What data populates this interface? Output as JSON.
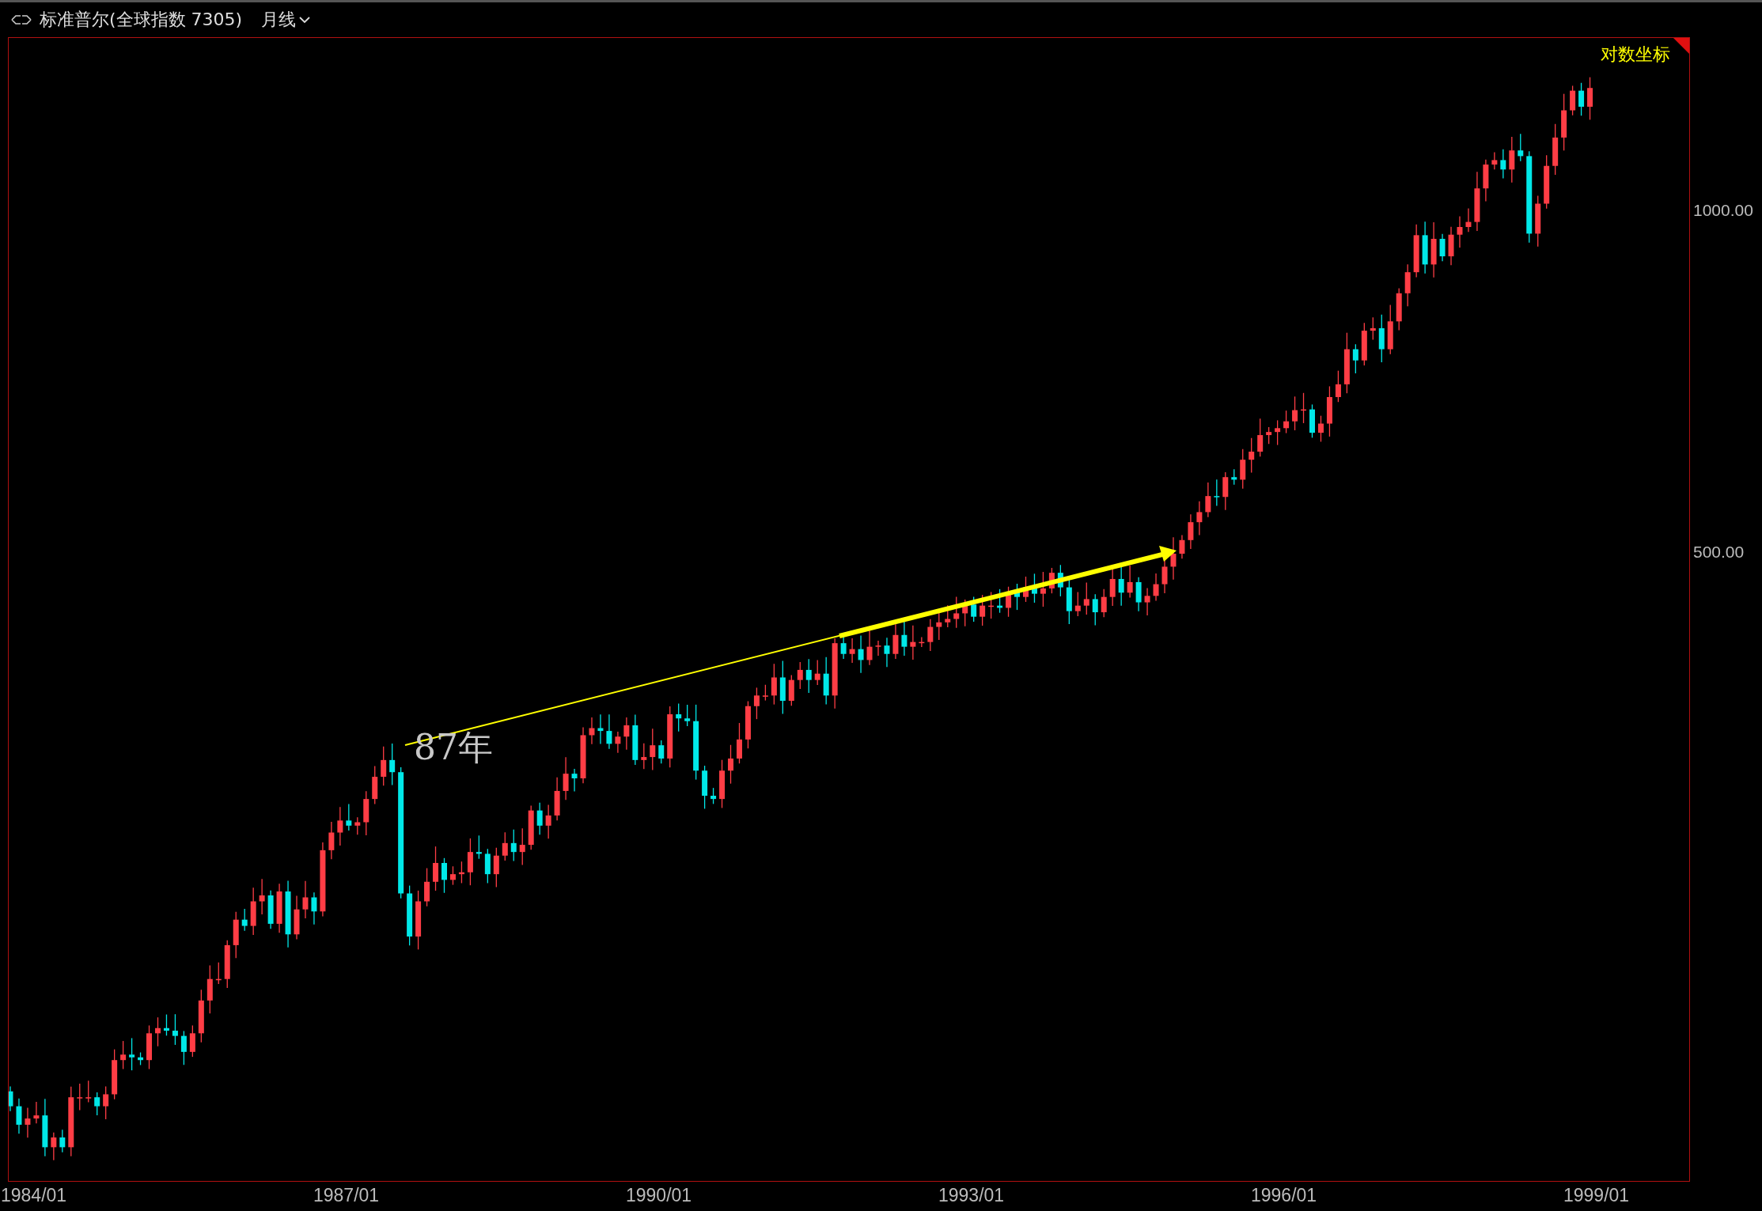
{
  "header": {
    "title": "标准普尔(全球指数 7305)",
    "period": "月线"
  },
  "chart": {
    "scale_mode": "对数坐标",
    "annotation": "87年",
    "y_axis_labels": [
      "1000.00",
      "500.00"
    ],
    "x_axis_labels": [
      "1984/01",
      "1987/01",
      "1990/01",
      "1993/01",
      "1996/01",
      "1999/01"
    ]
  }
}
